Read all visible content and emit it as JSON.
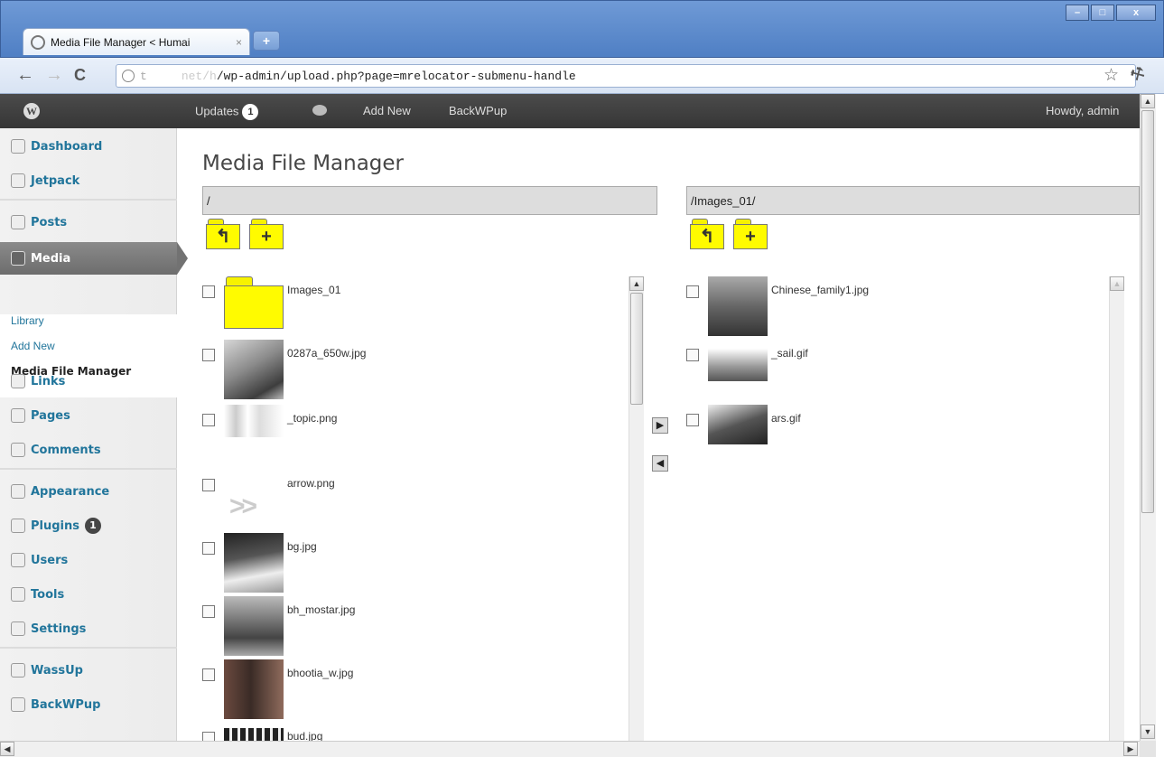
{
  "browser": {
    "tab_title": "Media File Manager < Humai",
    "tab_close": "×",
    "new_tab": "+",
    "url_host": "t",
    "url_host_blur": "net/h",
    "url_path": "/wp-admin/upload.php?page=mrelocator-submenu-handle",
    "window_controls": [
      "–",
      "□",
      "x"
    ]
  },
  "adminbar": {
    "updates_label": "Updates",
    "updates_count": "1",
    "add_new": "Add New",
    "backwpup": "BackWPup",
    "howdy": "Howdy, admin"
  },
  "sidebar": {
    "items": [
      {
        "label": "Dashboard"
      },
      {
        "label": "Jetpack"
      },
      {
        "label": "Posts"
      },
      {
        "label": "Media"
      },
      {
        "label": "Links"
      },
      {
        "label": "Pages"
      },
      {
        "label": "Comments"
      },
      {
        "label": "Appearance"
      },
      {
        "label": "Plugins",
        "badge": "1"
      },
      {
        "label": "Users"
      },
      {
        "label": "Tools"
      },
      {
        "label": "Settings"
      },
      {
        "label": "WassUp"
      },
      {
        "label": "BackWPup"
      }
    ],
    "submenu": [
      "Library",
      "Add New",
      "Media File Manager"
    ]
  },
  "page": {
    "title": "Media File Manager",
    "left_path": "/",
    "right_path": "/Images_01/",
    "folder_up": "↰",
    "folder_new": "+"
  },
  "left_files": [
    "Images_01",
    "0287a_650w.jpg",
    "_topic.png",
    "arrow.png",
    "bg.jpg",
    "bh_mostar.jpg",
    "bhootia_w.jpg",
    "bud.jpg"
  ],
  "right_files": [
    "Chinese_family1.jpg",
    "_sail.gif",
    "ars.gif"
  ],
  "move_right": "▶",
  "move_left": "◀",
  "colors": {
    "link": "#21759b",
    "adminbar": "#464646",
    "folder": "#fffb00"
  }
}
